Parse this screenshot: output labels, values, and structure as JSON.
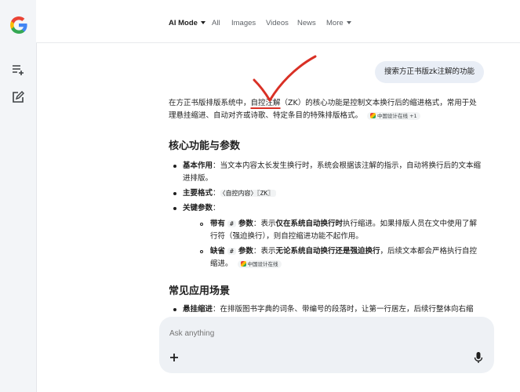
{
  "nav": {
    "tabs": [
      {
        "label": "AI Mode"
      },
      {
        "label": "All"
      },
      {
        "label": "Images"
      },
      {
        "label": "Videos"
      },
      {
        "label": "News"
      },
      {
        "label": "More"
      }
    ]
  },
  "query": "搜索方正书版zk注解的功能",
  "intro": {
    "part1": "在方正书版排版系统中，",
    "highlight": "自控注解",
    "part2": "（ZK）的核心功能是控制文本换行后的缩进格式，常用于处理悬挂缩进、自动对齐或诗歌、特定条目的特殊排版格式。",
    "citation": "中国设计在线 +1"
  },
  "section1": {
    "title": "核心功能与参数",
    "items": [
      {
        "label": "基本作用",
        "sep": "：",
        "text": "当文本内容太长发生换行时，系统会根据该注解的指示，自动将换行后的文本缩进排版。"
      },
      {
        "label": "主要格式",
        "sep": "：",
        "code": "〈自控内容〉〖ZK〗"
      },
      {
        "label": "关键参数",
        "sep": "："
      }
    ],
    "subitems": [
      {
        "label_a": "带有",
        "symbol": "#",
        "label_b": "参数",
        "sep": "：",
        "pre": "表示",
        "bold": "仅在系统自动换行时",
        "post": "执行缩进。如果排版人员在文中使用了解行符（强迫换行），则自控缩进功能不起作用。"
      },
      {
        "label_a": "缺省",
        "symbol": "#",
        "label_b": "参数",
        "sep": "：",
        "pre": "表示",
        "bold": "无论系统自动换行还是强迫换行",
        "post": "，后续文本都会严格执行自控缩进。",
        "citation": "中国设计在线"
      }
    ]
  },
  "section2": {
    "title": "常见应用场景",
    "items": [
      {
        "label": "悬挂缩进",
        "sep": "：",
        "text": "在排版图书字典的词条、带编号的段落时，让第一行居左，后续行整体向右缩"
      }
    ]
  },
  "ask": {
    "placeholder": "Ask anything"
  },
  "colors": {
    "accent": "#1a73e8",
    "annotation": "#d93025",
    "chip": "#e9eef6",
    "rail": "#f3f5f8"
  },
  "icons": [
    "google-logo-icon",
    "new-chat-list-icon",
    "edit-icon",
    "plus-icon",
    "mic-icon",
    "checkmark-annotation-icon"
  ]
}
